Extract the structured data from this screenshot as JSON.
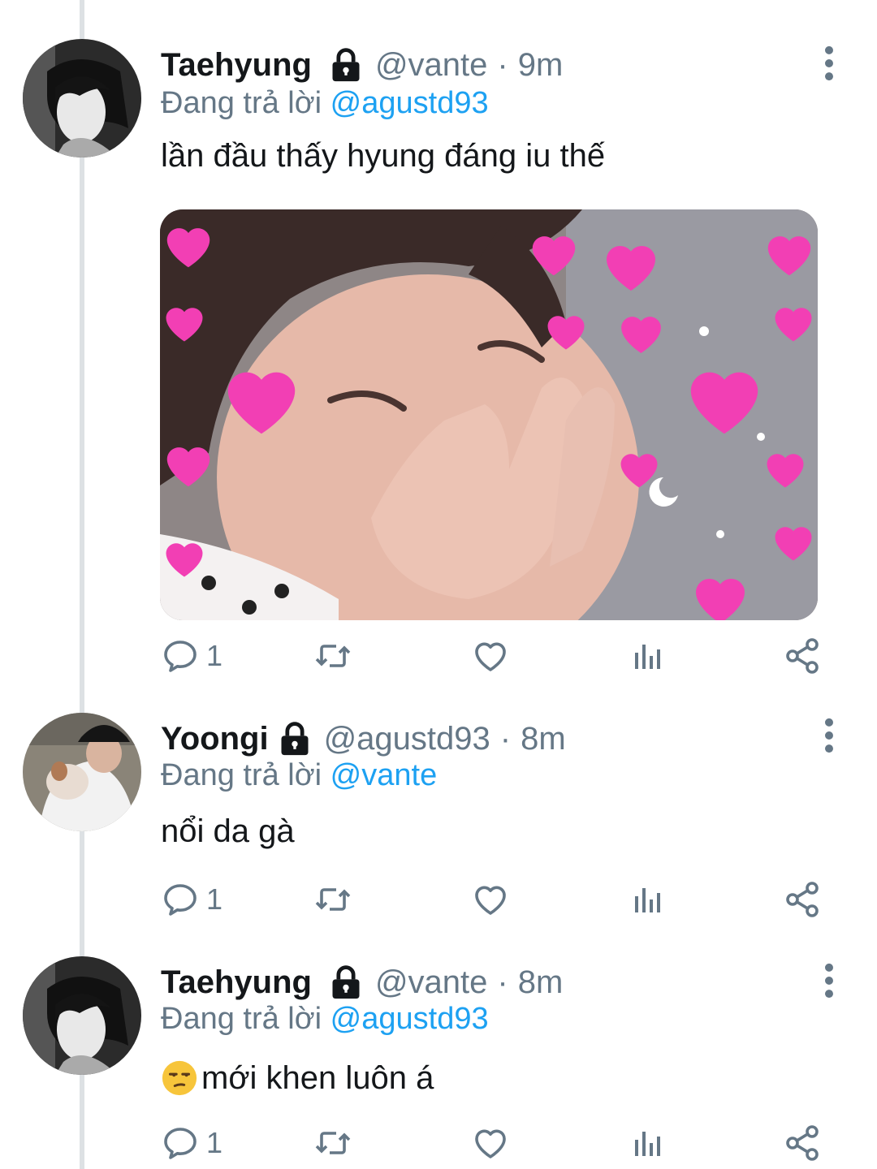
{
  "colors": {
    "text": "#14171a",
    "secondary": "#657786",
    "link": "#1da1f2",
    "thread_line": "#dde1e4"
  },
  "tweets": [
    {
      "display_name": "Taehyung",
      "handle": "@vante",
      "separator": "·",
      "time": "9m",
      "replying_prefix": "Đang trả lời",
      "replying_to": "@agustd93",
      "text": "lần đầu thấy hyung đáng iu thế",
      "has_media": true,
      "reply_count": "1",
      "icons": [
        "lock-icon",
        "more-vertical-icon",
        "reply-icon",
        "retweet-icon",
        "like-icon",
        "stats-icon",
        "share-icon"
      ]
    },
    {
      "display_name": "Yoongi",
      "handle": "@agustd93",
      "separator": "·",
      "time": "8m",
      "replying_prefix": "Đang trả lời",
      "replying_to": "@vante",
      "text": "nổi da gà",
      "has_media": false,
      "reply_count": "1"
    },
    {
      "display_name": "Taehyung",
      "handle": "@vante",
      "separator": "·",
      "time": "8m",
      "replying_prefix": "Đang trả lời",
      "replying_to": "@agustd93",
      "text": "mới khen luôn á",
      "text_emoji": "unamused-face-emoji",
      "has_media": false,
      "reply_count": "1"
    }
  ]
}
